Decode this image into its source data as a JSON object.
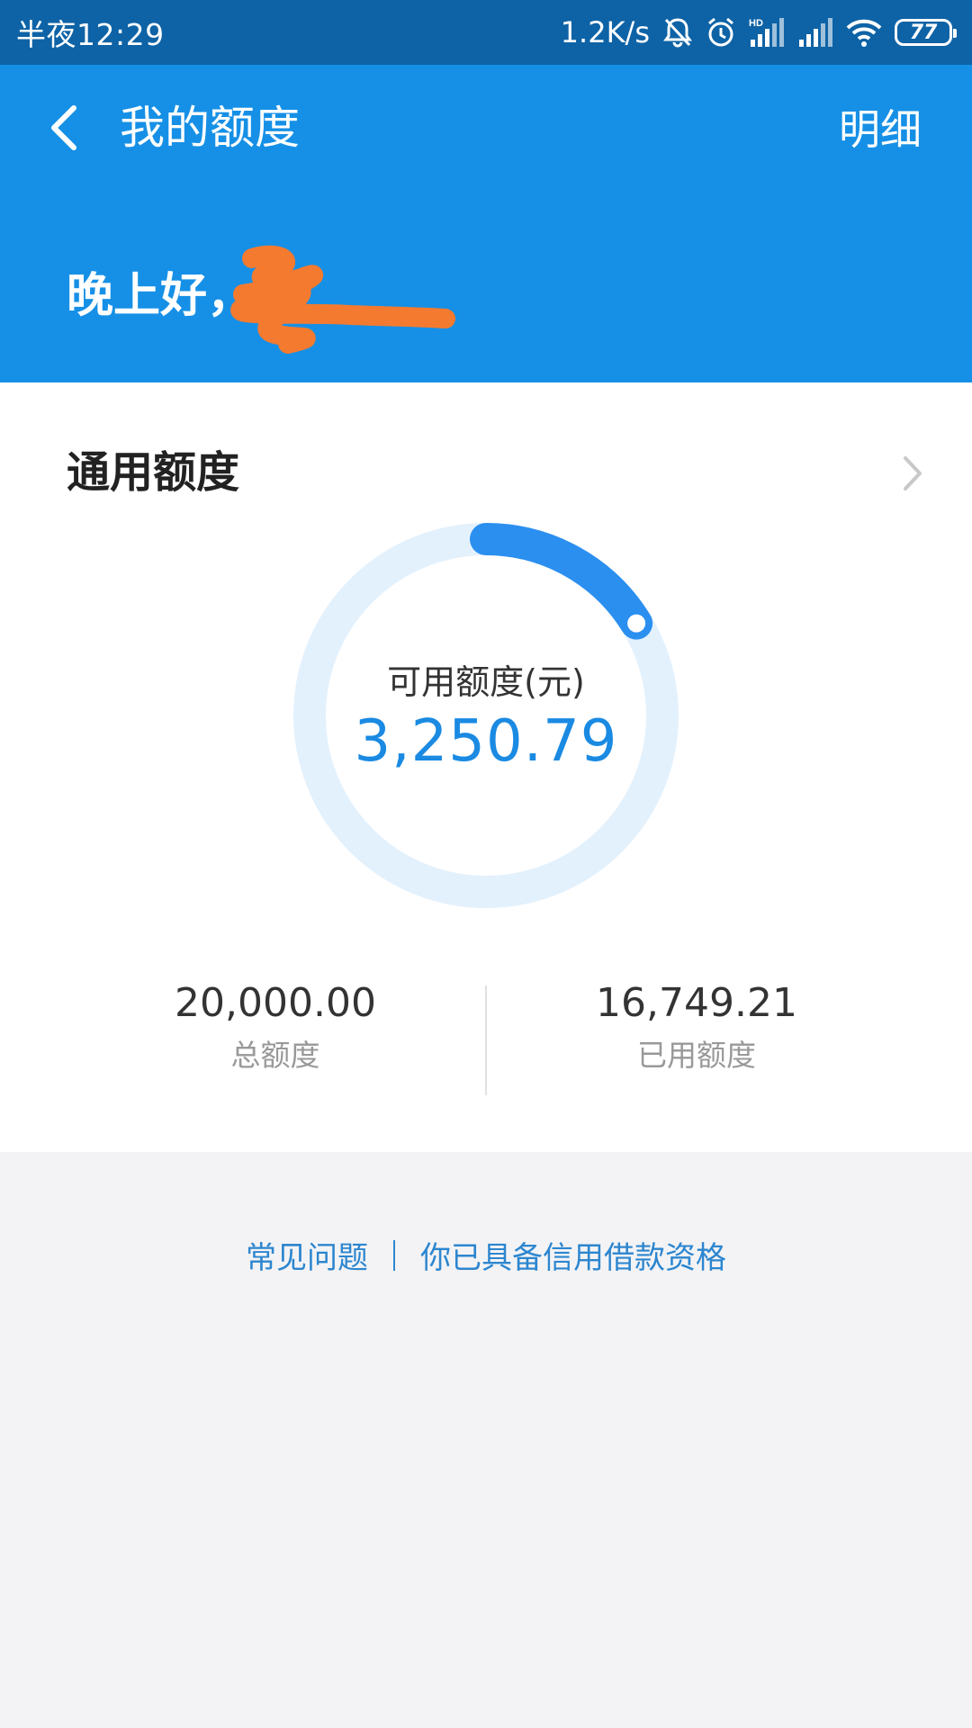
{
  "status_bar": {
    "time": "半夜12:29",
    "network_speed": "1.2K/s",
    "battery": "77",
    "icons": [
      "bell-muted-icon",
      "alarm-icon",
      "hd-signal-icon",
      "signal-icon",
      "wifi-icon",
      "battery-icon"
    ]
  },
  "header": {
    "title": "我的额度",
    "detail_label": "明细",
    "greeting": "晚上好，",
    "background_color": "#1690e6"
  },
  "card": {
    "title": "通用额度",
    "available_label": "可用额度(元)",
    "available_value": "3,250.79",
    "available_fraction": 0.1625,
    "total_value": "20,000.00",
    "total_label": "总额度",
    "used_value": "16,749.21",
    "used_label": "已用额度",
    "accent_color": "#2b8ff0",
    "ring_track_color": "#e3f1fd"
  },
  "footer": {
    "faq_label": "常见问题",
    "eligibility_label": "你已具备信用借款资格"
  }
}
